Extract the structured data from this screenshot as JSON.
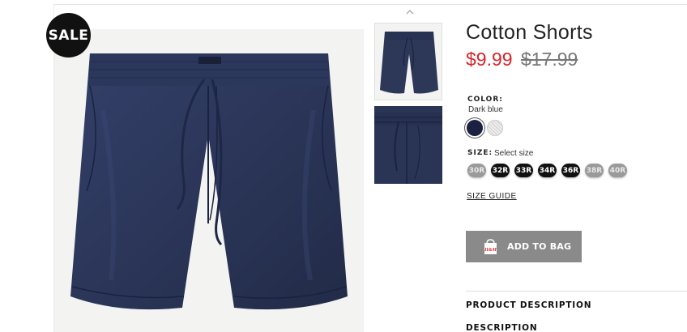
{
  "product": {
    "badge": "SALE",
    "title": "Cotton Shorts",
    "sale_price": "$9.99",
    "original_price": "$17.99",
    "image_color": "#2a3554"
  },
  "color": {
    "label": "COLOR:",
    "selected": "Dark blue",
    "swatches": [
      {
        "name": "Dark blue",
        "hex": "#1b2140",
        "selected": true
      },
      {
        "name": "Light pattern",
        "hex": "#e6e6e6",
        "selected": false
      }
    ]
  },
  "size": {
    "label": "SIZE:",
    "hint": "Select size",
    "options": [
      {
        "label": "30R",
        "available": false
      },
      {
        "label": "32R",
        "available": true
      },
      {
        "label": "33R",
        "available": true
      },
      {
        "label": "34R",
        "available": true
      },
      {
        "label": "36R",
        "available": true
      },
      {
        "label": "38R",
        "available": false
      },
      {
        "label": "40R",
        "available": false
      }
    ],
    "guide": "SIZE GUIDE"
  },
  "cart": {
    "add_label": "ADD TO BAG",
    "bag_logo": "H&M"
  },
  "sections": {
    "product_description": "PRODUCT DESCRIPTION",
    "description": "DESCRIPTION"
  },
  "colors": {
    "sale_red": "#d6232a",
    "button_gray": "#8a8a8a"
  },
  "icons": {
    "thumb_scroll": "chevron-up-icon",
    "bag": "shopping-bag-icon"
  }
}
